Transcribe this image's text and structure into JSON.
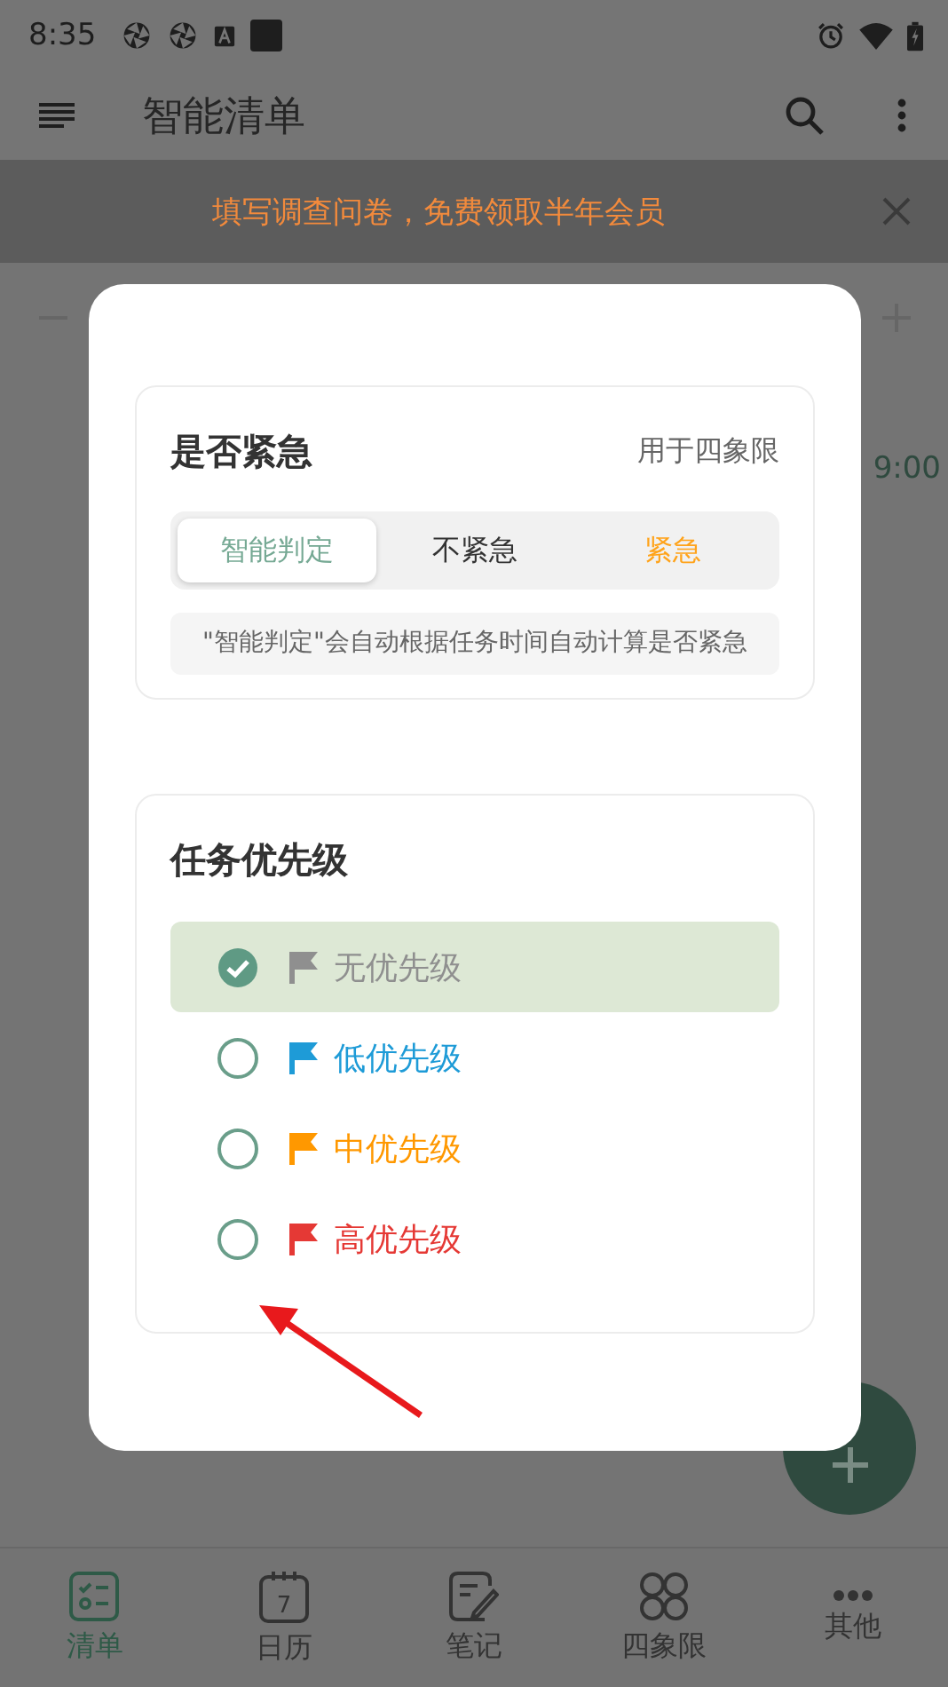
{
  "status_bar": {
    "time": "8:35"
  },
  "app_bar": {
    "title": "智能清单"
  },
  "banner": {
    "text": "填写调查问卷，免费领取半年会员"
  },
  "background": {
    "time": "9:00"
  },
  "dialog": {
    "urgency": {
      "title": "是否紧急",
      "hint": "用于四象限",
      "options": [
        {
          "label": "智能判定",
          "selected": true,
          "kind": "smart"
        },
        {
          "label": "不紧急",
          "selected": false,
          "kind": "normal"
        },
        {
          "label": "紧急",
          "selected": false,
          "kind": "urgent"
        }
      ],
      "note": "\"智能判定\"会自动根据任务时间自动计算是否紧急"
    },
    "priority": {
      "title": "任务优先级",
      "options": [
        {
          "label": "无优先级",
          "selected": true,
          "color": "#8f8f8f"
        },
        {
          "label": "低优先级",
          "selected": false,
          "color": "#1e9bd7"
        },
        {
          "label": "中优先级",
          "selected": false,
          "color": "#ff9800"
        },
        {
          "label": "高优先级",
          "selected": false,
          "color": "#e53935"
        }
      ]
    }
  },
  "bottom_nav": [
    {
      "label": "清单",
      "selected": true,
      "kind": "list"
    },
    {
      "label": "日历",
      "selected": false,
      "kind": "calendar",
      "icon_text": "7"
    },
    {
      "label": "笔记",
      "selected": false,
      "kind": "note"
    },
    {
      "label": "四象限",
      "selected": false,
      "kind": "quadrant"
    },
    {
      "label": "其他",
      "selected": false,
      "kind": "other"
    }
  ]
}
